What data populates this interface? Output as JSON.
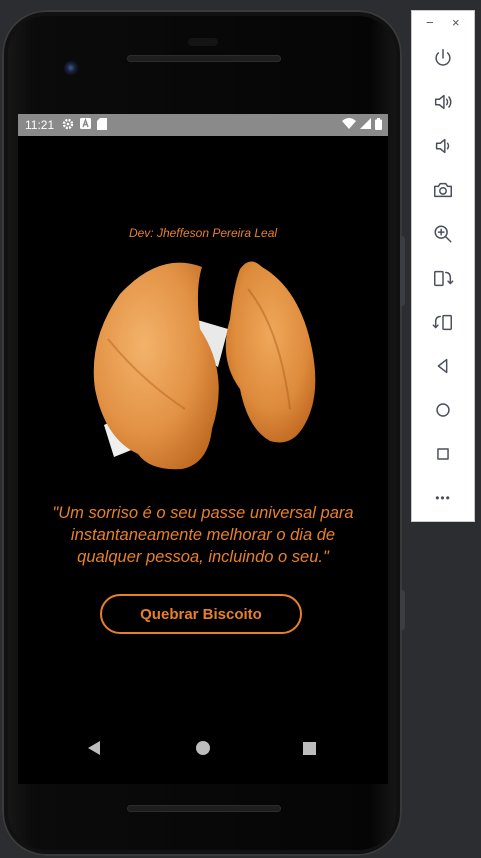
{
  "status_bar": {
    "time": "11:21",
    "left_icons": [
      "gear-icon",
      "a-icon",
      "sd-card-icon"
    ],
    "right_icons": [
      "wifi-icon",
      "signal-icon",
      "battery-icon"
    ]
  },
  "app": {
    "dev_credit": "Dev: Jheffeson Pereira Leal",
    "quote": "\"Um sorriso é o seu passe universal para instantaneamente melhorar o dia de qualquer pessoa, incluindo o seu.\"",
    "button_label": "Quebrar Biscoito",
    "accent_color": "#e8802a",
    "background_color": "#000000"
  },
  "nav_bar": {
    "buttons": [
      "back",
      "home",
      "recents"
    ]
  },
  "emulator_panel": {
    "minimize": "−",
    "close": "×",
    "tools": [
      "power-icon",
      "volume-up-icon",
      "volume-down-icon",
      "camera-icon",
      "zoom-icon",
      "rotate-left-icon",
      "rotate-right-icon",
      "back-icon",
      "home-icon",
      "overview-icon",
      "more-icon"
    ],
    "more_label": "•••"
  }
}
